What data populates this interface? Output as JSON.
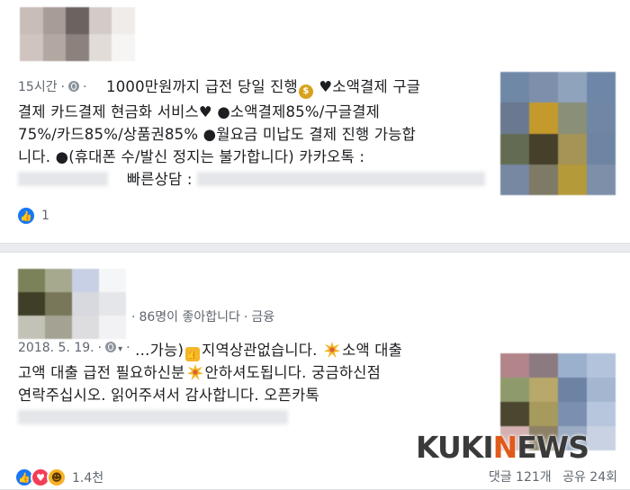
{
  "post1": {
    "time": "15시간",
    "lines": [
      "1000만원까지 급전 당일 진행",
      "♥소액결제 구글",
      "결제 카드결제 현금화 서비스♥ ●소액결제85%/구글결제",
      "75%/카드85%/상품권85% ●월요금 미납도 결제 진행 가능합",
      "니다. ●(휴대폰 수/발신 정지는 불가합니다) 카카오톡 :",
      "빠른상담 :"
    ],
    "reaction_count": "1"
  },
  "post2": {
    "meta_likes": "86명이 좋아합니다",
    "meta_category": "금융",
    "date": "2018. 5. 19.",
    "lines": [
      "…가능)",
      "지역상관없습니다.",
      "소액 대출",
      "고액 대출 급전 필요하신분",
      "안하셔도됩니다. 궁금하신점",
      "연락주십시오. 읽어주셔서 감사합니다. 오픈카톡"
    ],
    "reaction_count": "1.4천",
    "comments": "댓글 121개",
    "shares": "공유 24회"
  },
  "watermark": {
    "part1": "KUKI",
    "part2": "N",
    "part3": "EWS"
  },
  "colors": {
    "like": "#1877f2",
    "love": "#f33e58",
    "haha": "#f7b125",
    "meta_text": "#606770"
  },
  "icons": [
    "globe-icon",
    "money-bag-emoji",
    "thumbs-up-emoji",
    "burst-emoji",
    "like-reaction-icon",
    "love-reaction-icon",
    "haha-reaction-icon"
  ]
}
